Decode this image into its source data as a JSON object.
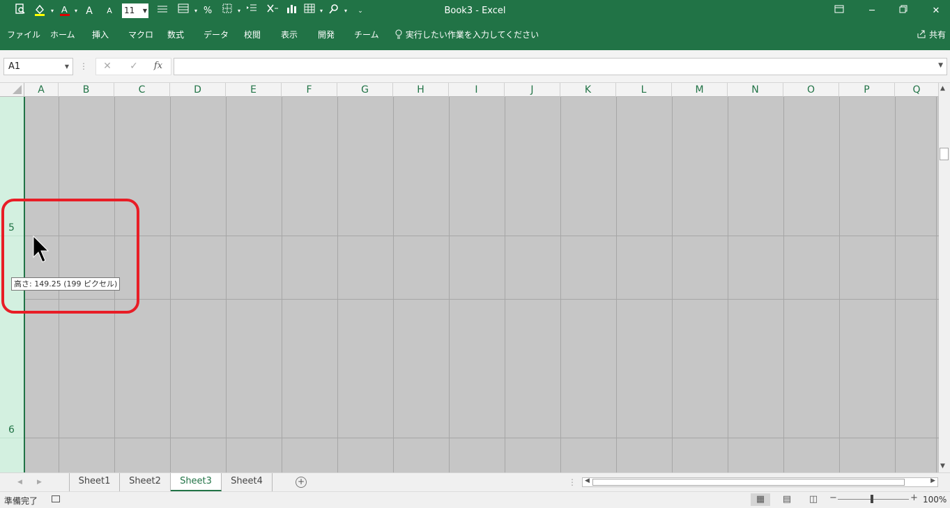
{
  "window": {
    "title": "Book3  -  Excel"
  },
  "quick_access": {
    "font_size": "11",
    "icons": [
      "print-preview-icon",
      "fill-color-icon",
      "font-color-icon",
      "increase-font-icon",
      "decrease-font-icon",
      "font-size-box",
      "align-icon",
      "format-icon",
      "percent-icon",
      "borders-icon",
      "indent-icon",
      "clear-icon",
      "chart-icon",
      "table-icon",
      "find-icon",
      "more-icon"
    ],
    "percent_symbol": "%",
    "increase_font": "A",
    "decrease_font": "A"
  },
  "menu": {
    "items": [
      "ファイル",
      "ホーム",
      "挿入",
      "マクロ",
      "数式",
      "データ",
      "校閲",
      "表示",
      "開発",
      "チーム"
    ],
    "tell_me": "実行したい作業を入力してください",
    "share": "共有"
  },
  "formula_bar": {
    "name_box": "A1",
    "formula": "",
    "fx_label": "fx"
  },
  "grid": {
    "columns": [
      "A",
      "B",
      "C",
      "D",
      "E",
      "F",
      "G",
      "H",
      "I",
      "J",
      "K",
      "L",
      "M",
      "N",
      "O",
      "P",
      "Q"
    ],
    "row_labels": [
      "5",
      "6"
    ]
  },
  "tooltip": {
    "text": "高さ: 149.25 (199 ピクセル)"
  },
  "sheets": {
    "tabs": [
      "Sheet1",
      "Sheet2",
      "Sheet3",
      "Sheet4"
    ],
    "active": "Sheet3"
  },
  "status": {
    "ready": "準備完了",
    "zoom": "100%"
  },
  "colors": {
    "accent": "#217346",
    "highlight_circle": "#e81d26",
    "cell_fill": "#c6c6c6"
  }
}
